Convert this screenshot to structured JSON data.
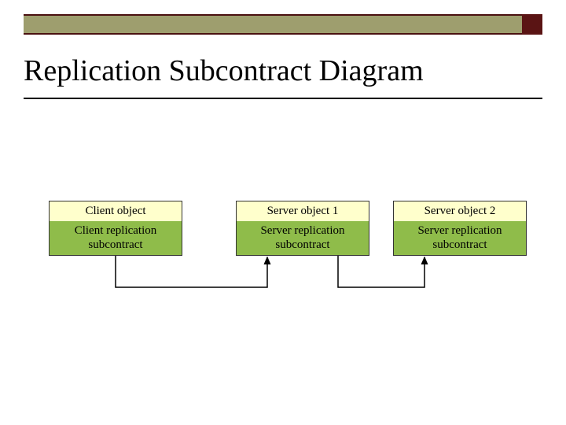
{
  "title": "Replication Subcontract Diagram",
  "client": {
    "object_label": "Client object",
    "subcontract_label": "Client replication subcontract"
  },
  "server1": {
    "object_label": "Server object 1",
    "subcontract_label": "Server replication subcontract"
  },
  "server2": {
    "object_label": "Server object 2",
    "subcontract_label": "Server replication subcontract"
  },
  "colors": {
    "band": "#9e9e6e",
    "band_border": "#4a1010",
    "corner_square": "#5a1414",
    "box_top_bg": "#ffffcc",
    "box_bottom_bg": "#8fbc4a"
  }
}
